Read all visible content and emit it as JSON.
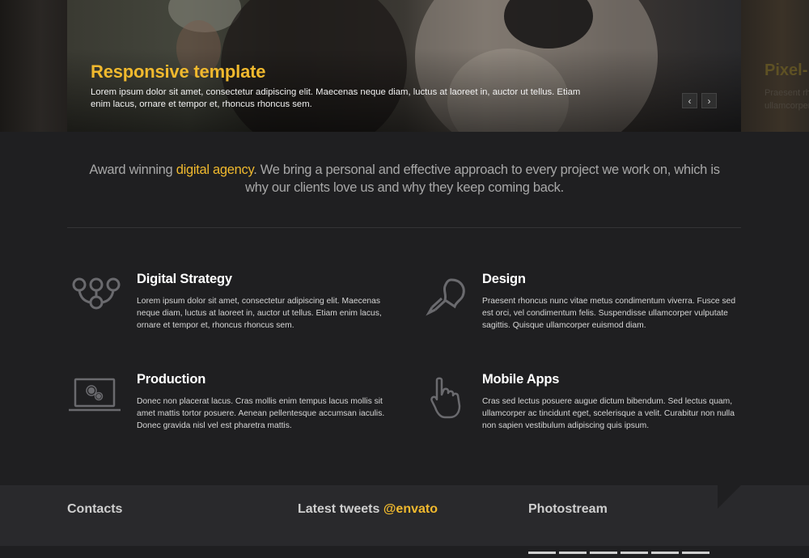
{
  "slider": {
    "title": "Responsive template",
    "text": "Lorem ipsum dolor sit amet, consectetur adipiscing elit. Maecenas neque diam, luctus at laoreet in, auctor ut tellus. Etiam enim lacus, ornare et tempor et, rhoncus rhoncus sem.",
    "prev_label": "‹",
    "next_label": "›",
    "next_slide_title": "Pixel-",
    "next_slide_line1": "Praesent rh",
    "next_slide_line2": "ullamcorper"
  },
  "intro": {
    "before": "Award winning ",
    "highlight": "digital agency",
    "after": ". We bring a personal and effective approach to every project we work on, which is why our clients love us and why they keep coming back."
  },
  "services": [
    {
      "title": "Digital Strategy",
      "icon": "network-icon",
      "text": "Lorem ipsum dolor sit amet, consectetur adipiscing elit. Maecenas neque diam, luctus at laoreet in, auctor ut tellus. Etiam enim lacus, ornare et tempor et, rhoncus rhoncus sem."
    },
    {
      "title": "Design",
      "icon": "lightbulb-icon",
      "text": "Praesent rhoncus nunc vitae metus condimentum viverra. Fusce sed est orci, vel condimentum felis. Suspendisse ullamcorper vulputate sagittis. Quisque ullamcorper euismod diam."
    },
    {
      "title": "Production",
      "icon": "laptop-gears-icon",
      "text": "Donec non placerat lacus. Cras mollis enim tempus lacus mollis sit amet mattis tortor posuere. Aenean pellentesque accumsan iaculis. Donec gravida nisl vel est pharetra mattis."
    },
    {
      "title": "Mobile Apps",
      "icon": "pointing-hand-icon",
      "text": "Cras sed lectus posuere augue dictum bibendum. Sed lectus quam, ullamcorper ac tincidunt eget, scelerisque a velit. Curabitur non nulla non sapien vestibulum adipiscing quis ipsum."
    }
  ],
  "footer": {
    "contacts_title": "Contacts",
    "tweets_title": "Latest tweets ",
    "tweets_handle": "@envato",
    "photostream_title": "Photostream"
  },
  "colors": {
    "accent": "#f0b92e",
    "background": "#1f1f21",
    "footer": "#29292c"
  }
}
